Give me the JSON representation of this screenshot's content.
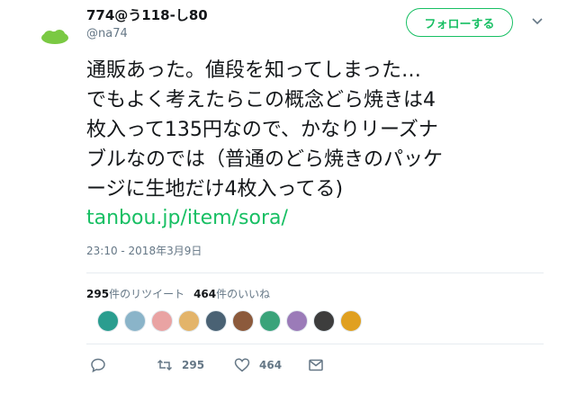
{
  "user": {
    "display_name": "774@う118-し80",
    "handle": "@na74"
  },
  "follow_button": {
    "label": "フォローする"
  },
  "tweet": {
    "lines": [
      "通販あった。値段を知ってしまった…",
      "でもよく考えたらこの概念どら焼きは4",
      "枚入って135円なので、かなりリーズナ",
      "ブルなのでは（普通のどら焼きのパッケ",
      "ージに生地だけ4枚入ってる)"
    ],
    "link": "tanbou.jp/item/sora/",
    "timestamp": "23:10 - 2018年3月9日"
  },
  "stats": {
    "retweets_count": "295",
    "retweets_label": "件のリツイート",
    "likes_count": "464",
    "likes_label": "件のいいね"
  },
  "actions": {
    "retweet_count": "295",
    "like_count": "464"
  },
  "colors": {
    "accent": "#17bf63",
    "muted": "#657786",
    "text": "#14171a",
    "divider": "#e6ecf0"
  },
  "likers": [
    {
      "name": "liker-avatar-1",
      "color": "#2a9d8f"
    },
    {
      "name": "liker-avatar-2",
      "color": "#8ab4c9"
    },
    {
      "name": "liker-avatar-3",
      "color": "#e9a3a3"
    },
    {
      "name": "liker-avatar-4",
      "color": "#e3b46a"
    },
    {
      "name": "liker-avatar-5",
      "color": "#4a6274"
    },
    {
      "name": "liker-avatar-6",
      "color": "#8c5a3c"
    },
    {
      "name": "liker-avatar-7",
      "color": "#3aa37a"
    },
    {
      "name": "liker-avatar-8",
      "color": "#9b7bb8"
    },
    {
      "name": "liker-avatar-9",
      "color": "#3d3d3d"
    },
    {
      "name": "liker-avatar-10",
      "color": "#e0a020"
    }
  ]
}
